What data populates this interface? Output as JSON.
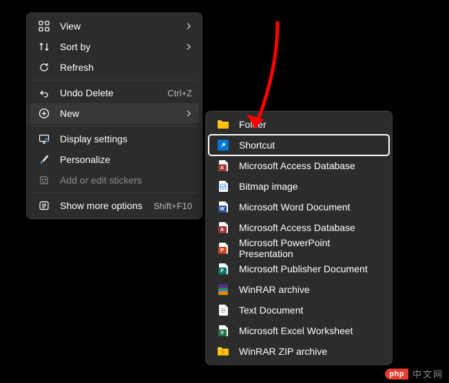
{
  "contextMenu": {
    "items": [
      {
        "icon": "view",
        "label": "View",
        "chevron": true
      },
      {
        "icon": "sort",
        "label": "Sort by",
        "chevron": true
      },
      {
        "icon": "refresh",
        "label": "Refresh"
      },
      {
        "sep": true
      },
      {
        "icon": "undo",
        "label": "Undo Delete",
        "shortcut": "Ctrl+Z"
      },
      {
        "icon": "new",
        "label": "New",
        "chevron": true,
        "hover": true
      },
      {
        "sep": true
      },
      {
        "icon": "display",
        "label": "Display settings"
      },
      {
        "icon": "personalize",
        "label": "Personalize"
      },
      {
        "icon": "stickers",
        "label": "Add or edit stickers",
        "disabled": true
      },
      {
        "sep": true
      },
      {
        "icon": "more",
        "label": "Show more options",
        "shortcut": "Shift+F10"
      }
    ]
  },
  "submenu": {
    "items": [
      {
        "icon": "folder",
        "label": "Folder"
      },
      {
        "icon": "shortcut",
        "label": "Shortcut",
        "highlighted": true
      },
      {
        "icon": "access",
        "label": "Microsoft Access Database"
      },
      {
        "icon": "bitmap",
        "label": "Bitmap image"
      },
      {
        "icon": "word",
        "label": "Microsoft Word Document"
      },
      {
        "icon": "access",
        "label": "Microsoft Access Database"
      },
      {
        "icon": "powerpoint",
        "label": "Microsoft PowerPoint Presentation"
      },
      {
        "icon": "publisher",
        "label": "Microsoft Publisher Document"
      },
      {
        "icon": "rar",
        "label": "WinRAR archive"
      },
      {
        "icon": "text",
        "label": "Text Document"
      },
      {
        "icon": "excel",
        "label": "Microsoft Excel Worksheet"
      },
      {
        "icon": "zip",
        "label": "WinRAR ZIP archive"
      }
    ]
  },
  "watermark": {
    "badge": "php",
    "text": "中文网"
  },
  "colors": {
    "access": "#a4373a",
    "word": "#2b579a",
    "ppt": "#d24726",
    "pub": "#077568",
    "excel": "#217346",
    "folder": "#ffd23e",
    "shortcut": "#0078d4",
    "rar1": "#5a2d82",
    "rar2": "#e08c00",
    "rar3": "#1e8e3e"
  }
}
